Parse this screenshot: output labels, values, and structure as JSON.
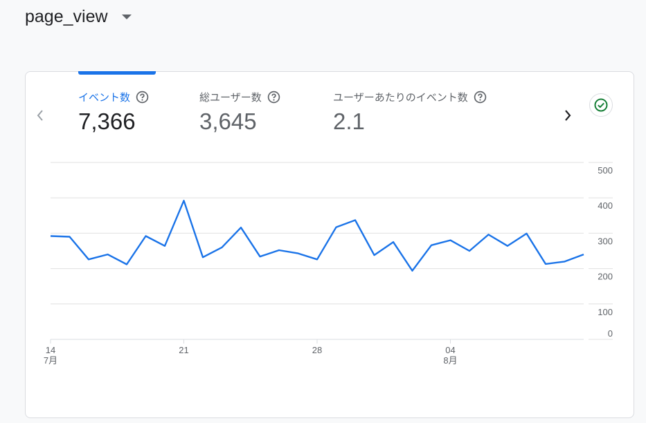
{
  "header": {
    "event_name": "page_view"
  },
  "metrics": [
    {
      "label": "イベント数",
      "value": "7,366",
      "active": true
    },
    {
      "label": "総ユーザー数",
      "value": "3,645",
      "active": false
    },
    {
      "label": "ユーザーあたりのイベント数",
      "value": "2.1",
      "active": false
    }
  ],
  "colors": {
    "accent": "#1a73e8",
    "check": "#188038"
  },
  "chart_data": {
    "type": "line",
    "ylim": [
      0,
      500
    ],
    "y_ticks": [
      "500",
      "400",
      "300",
      "200",
      "100",
      "0"
    ],
    "x_ticks": [
      {
        "day": "14",
        "month": "7月"
      },
      {
        "day": "21",
        "month": ""
      },
      {
        "day": "28",
        "month": ""
      },
      {
        "day": "04",
        "month": "8月"
      }
    ],
    "x": [
      "7/14",
      "7/15",
      "7/16",
      "7/17",
      "7/18",
      "7/19",
      "7/20",
      "7/21",
      "7/22",
      "7/23",
      "7/24",
      "7/25",
      "7/26",
      "7/27",
      "7/28",
      "7/29",
      "7/30",
      "7/31",
      "8/01",
      "8/02",
      "8/03",
      "8/04",
      "8/05",
      "8/06",
      "8/07",
      "8/08",
      "8/09",
      "8/10",
      "8/11"
    ],
    "series": [
      {
        "values": [
          292,
          290,
          226,
          240,
          212,
          292,
          264,
          392,
          232,
          260,
          316,
          234,
          252,
          243,
          226,
          317,
          337,
          238,
          275,
          194,
          266,
          280,
          250,
          296,
          264,
          299,
          213,
          220,
          240
        ]
      }
    ]
  }
}
